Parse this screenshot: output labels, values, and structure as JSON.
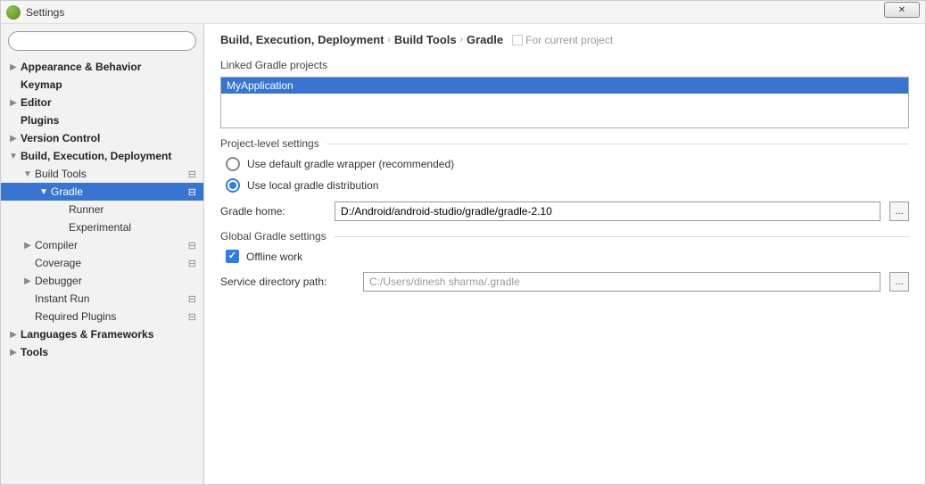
{
  "window": {
    "title": "Settings"
  },
  "sidebar": {
    "search_placeholder": "",
    "items": [
      {
        "label": "Appearance & Behavior",
        "bold": true,
        "arrow": "▶",
        "level": 0
      },
      {
        "label": "Keymap",
        "bold": true,
        "arrow": "",
        "level": 0
      },
      {
        "label": "Editor",
        "bold": true,
        "arrow": "▶",
        "level": 0
      },
      {
        "label": "Plugins",
        "bold": true,
        "arrow": "",
        "level": 0
      },
      {
        "label": "Version Control",
        "bold": true,
        "arrow": "▶",
        "level": 0
      },
      {
        "label": "Build, Execution, Deployment",
        "bold": true,
        "arrow": "▼",
        "level": 0
      },
      {
        "label": "Build Tools",
        "bold": false,
        "arrow": "▼",
        "level": 1,
        "badge": "⊟"
      },
      {
        "label": "Gradle",
        "bold": false,
        "arrow": "▼",
        "level": 2,
        "selected": true,
        "badge": "⊟"
      },
      {
        "label": "Runner",
        "bold": false,
        "arrow": "",
        "level": 3
      },
      {
        "label": "Experimental",
        "bold": false,
        "arrow": "",
        "level": 3
      },
      {
        "label": "Compiler",
        "bold": false,
        "arrow": "▶",
        "level": 1,
        "badge": "⊟"
      },
      {
        "label": "Coverage",
        "bold": false,
        "arrow": "",
        "level": 1,
        "badge": "⊟"
      },
      {
        "label": "Debugger",
        "bold": false,
        "arrow": "▶",
        "level": 1
      },
      {
        "label": "Instant Run",
        "bold": false,
        "arrow": "",
        "level": 1,
        "badge": "⊟"
      },
      {
        "label": "Required Plugins",
        "bold": false,
        "arrow": "",
        "level": 1,
        "badge": "⊟"
      },
      {
        "label": "Languages & Frameworks",
        "bold": true,
        "arrow": "▶",
        "level": 0
      },
      {
        "label": "Tools",
        "bold": true,
        "arrow": "▶",
        "level": 0
      }
    ]
  },
  "breadcrumb": {
    "c1": "Build, Execution, Deployment",
    "c2": "Build Tools",
    "c3": "Gradle",
    "hint": "For current project"
  },
  "sections": {
    "linked_title": "Linked Gradle projects",
    "linked_item": "MyApplication",
    "project_title": "Project-level settings",
    "radio_default": "Use default gradle wrapper (recommended)",
    "radio_local": "Use local gradle distribution",
    "gradle_home_label": "Gradle home:",
    "gradle_home_value": "D:/Android/android-studio/gradle/gradle-2.10",
    "global_title": "Global Gradle settings",
    "offline_label": "Offline work",
    "service_dir_label": "Service directory path:",
    "service_dir_value": "C:/Users/dinesh sharma/.gradle",
    "browse": "..."
  }
}
